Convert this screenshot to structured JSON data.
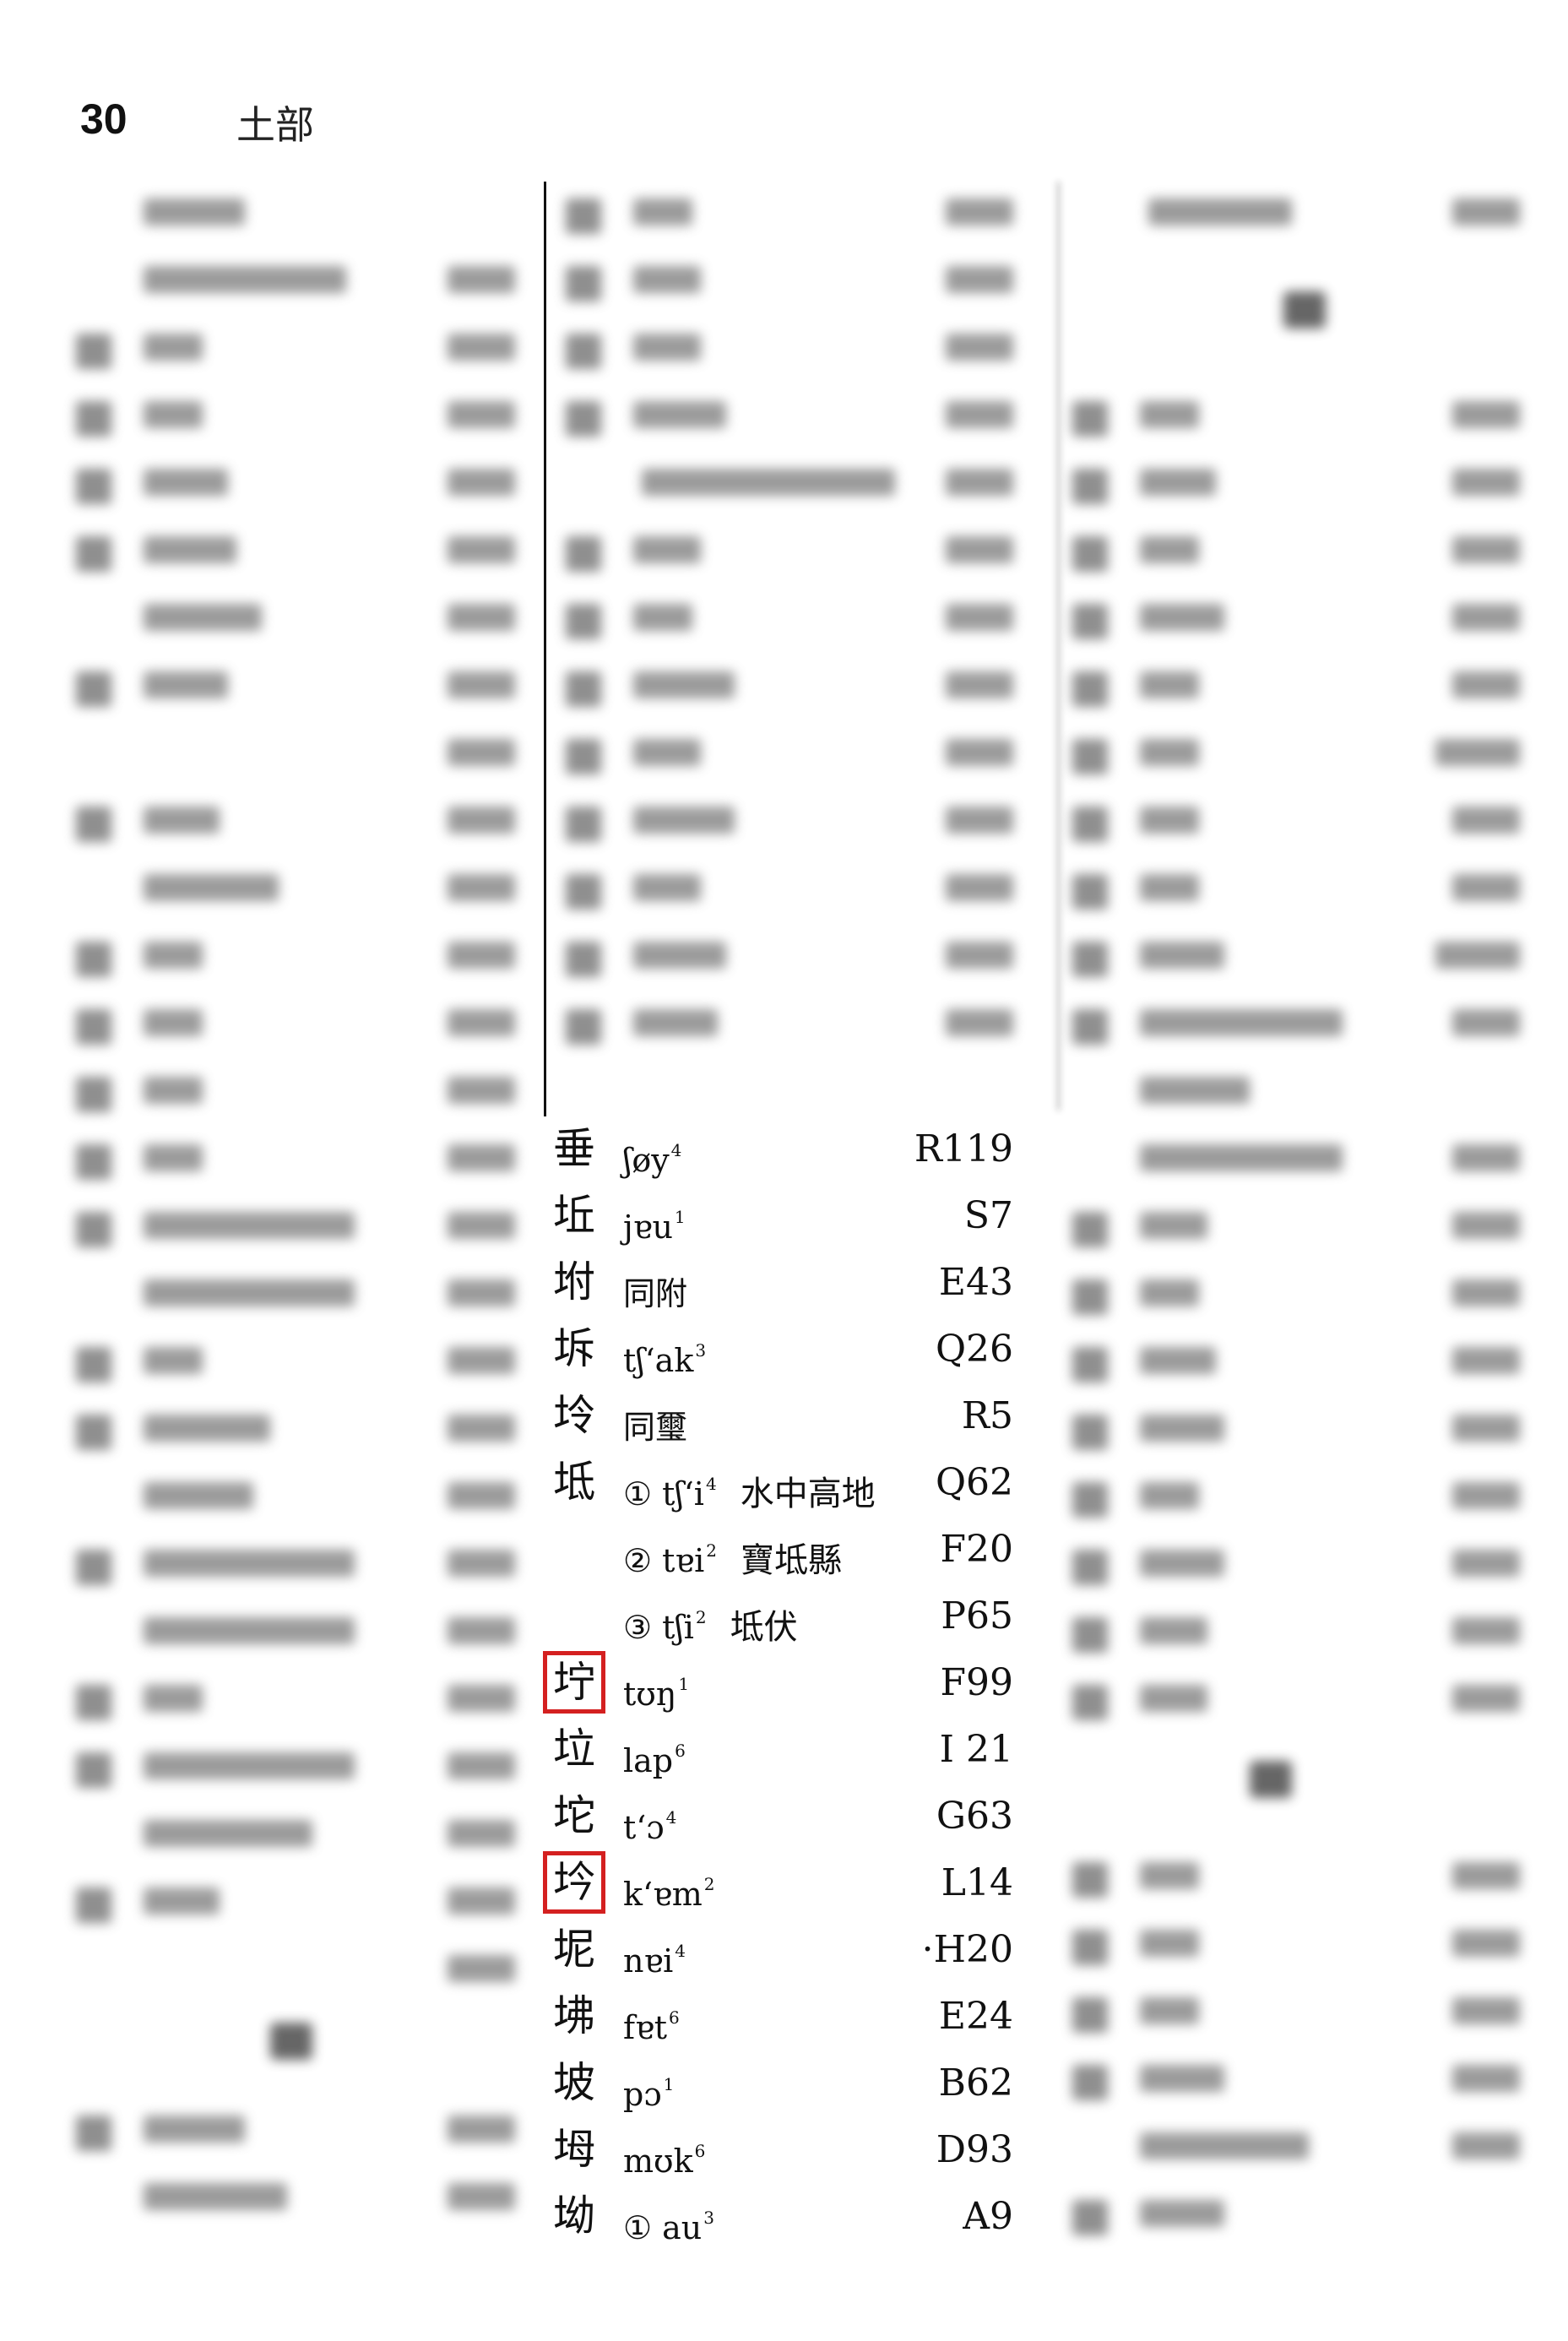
{
  "page_header": {
    "page_number": "30",
    "section_title": "土部"
  },
  "entries": [
    {
      "head": "垂",
      "pron": "ʃøy",
      "tone": "4",
      "gloss": "",
      "code": "R119",
      "boxed": false
    },
    {
      "head": "坵",
      "pron": "jɐu",
      "tone": "1",
      "gloss": "",
      "code": "S7",
      "boxed": false
    },
    {
      "head": "坿",
      "pron": "同附",
      "tone": "",
      "gloss": "",
      "code": "E43",
      "boxed": false
    },
    {
      "head": "坼",
      "pron": "tʃʻak",
      "tone": "3",
      "gloss": "",
      "code": "Q26",
      "boxed": false
    },
    {
      "head": "坽",
      "pron": "同璽",
      "tone": "",
      "gloss": "",
      "code": "R5",
      "boxed": false
    },
    {
      "head": "坻",
      "pron": "① tʃʻi",
      "tone": "4",
      "gloss": "水中高地",
      "code": "Q62",
      "boxed": false
    },
    {
      "head": "",
      "pron": "② tɐi",
      "tone": "2",
      "gloss": "寶坻縣",
      "code": "F20",
      "boxed": false
    },
    {
      "head": "",
      "pron": "③ tʃi",
      "tone": "2",
      "gloss": "坻伏",
      "code": "P65",
      "boxed": false
    },
    {
      "head": "坾",
      "pron": "tʊŋ",
      "tone": "1",
      "gloss": "",
      "code": "F99",
      "boxed": true
    },
    {
      "head": "垃",
      "pron": "lap",
      "tone": "6",
      "gloss": "",
      "code": "I 21",
      "boxed": false
    },
    {
      "head": "坨",
      "pron": "tʻɔ",
      "tone": "4",
      "gloss": "",
      "code": "G63",
      "boxed": false
    },
    {
      "head": "坅",
      "pron": "kʻɐm",
      "tone": "2",
      "gloss": "",
      "code": "L14",
      "boxed": true
    },
    {
      "head": "坭",
      "pron": "nɐi",
      "tone": "4",
      "gloss": "",
      "code": "·H20",
      "boxed": false
    },
    {
      "head": "坲",
      "pron": "fɐt",
      "tone": "6",
      "gloss": "",
      "code": "E24",
      "boxed": false
    },
    {
      "head": "坡",
      "pron": "pɔ",
      "tone": "1",
      "gloss": "",
      "code": "B62",
      "boxed": false
    },
    {
      "head": "坶",
      "pron": "mʊk",
      "tone": "6",
      "gloss": "",
      "code": "D93",
      "boxed": false
    },
    {
      "head": "坳",
      "pron": "① au",
      "tone": "3",
      "gloss": "",
      "code": "A9",
      "boxed": false
    }
  ],
  "colors": {
    "highlight_box": "#d42020",
    "text": "#111111",
    "background": "#ffffff"
  }
}
